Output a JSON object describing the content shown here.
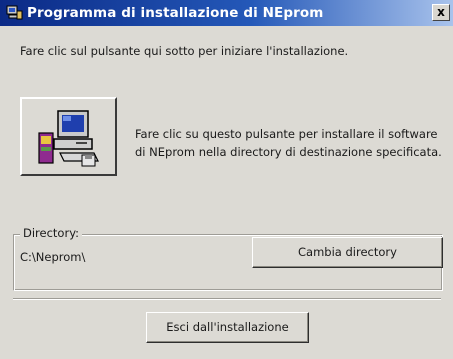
{
  "window": {
    "title": "Programma di installazione di NEprom",
    "close_glyph": "x"
  },
  "intro_text": "Fare clic sul pulsante qui sotto per iniziare l'installazione.",
  "setup_button": {
    "icon": "computer-setup-icon",
    "description_line1": "Fare clic su questo pulsante per installare il software",
    "description_line2": "di NEprom nella directory di destinazione specificata."
  },
  "directory": {
    "label": "Directory:",
    "value": "C:\\Neprom\\",
    "change_button_label": "Cambia directory"
  },
  "exit_button_label": "Esci dall'installazione",
  "colors": {
    "titlebar_start": "#0b2a86",
    "titlebar_end": "#a9c3ec",
    "face": "#dcdad4"
  }
}
